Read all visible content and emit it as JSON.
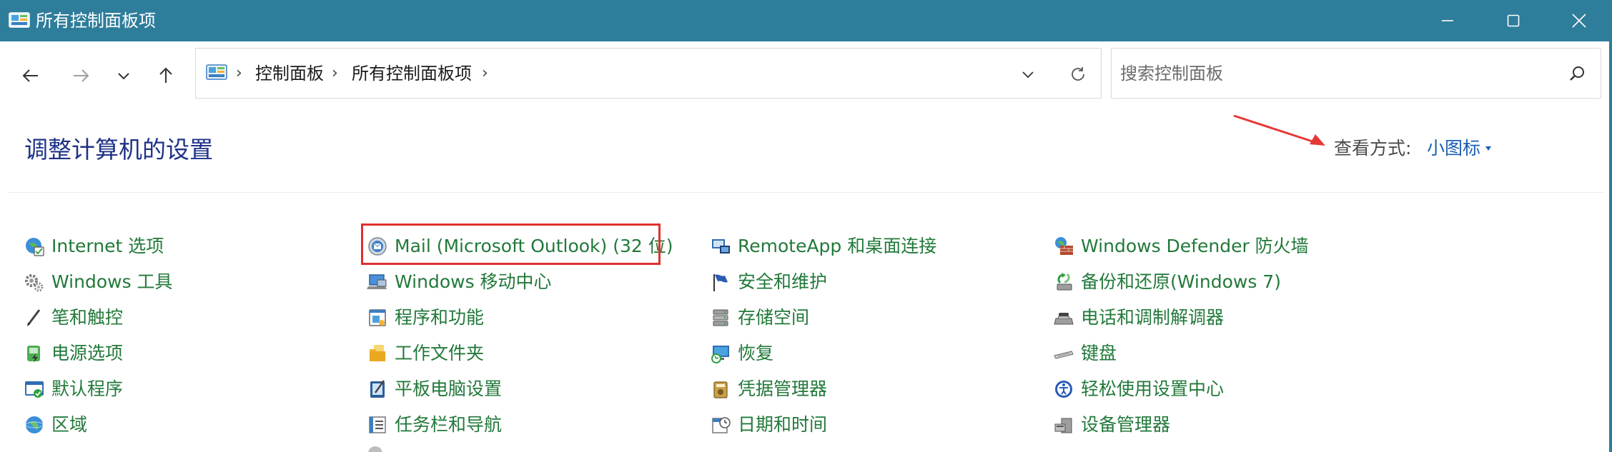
{
  "window": {
    "title": "所有控制面板项",
    "minimize_icon": "minimize-icon",
    "maximize_icon": "maximize-icon",
    "close_icon": "close-icon"
  },
  "navigation": {
    "back_icon": "arrow-left-icon",
    "forward_icon": "arrow-right-icon",
    "recent_icon": "chevron-down-icon",
    "up_icon": "arrow-up-icon",
    "breadcrumbs": [
      "控制面板",
      "所有控制面板项"
    ],
    "refresh_icon": "refresh-icon"
  },
  "search": {
    "placeholder": "搜索控制面板",
    "value": ""
  },
  "header": {
    "title": "调整计算机的设置",
    "view_label": "查看方式:",
    "view_value": "小图标"
  },
  "colors": {
    "titlebar": "#2e7d9b",
    "item_text": "#22793a",
    "title_text": "#1e3287",
    "link_text": "#1a5fb4",
    "highlight": "#e03030"
  },
  "items": {
    "col1": [
      {
        "label": "Internet 选项",
        "icon": "globe-icon"
      },
      {
        "label": "Windows 工具",
        "icon": "gears-icon"
      },
      {
        "label": "笔和触控",
        "icon": "pen-icon"
      },
      {
        "label": "电源选项",
        "icon": "power-icon"
      },
      {
        "label": "默认程序",
        "icon": "default-programs-icon"
      },
      {
        "label": "区域",
        "icon": "region-globe-icon"
      }
    ],
    "col2": [
      {
        "label": "Mail (Microsoft Outlook) (32 位)",
        "icon": "mail-icon"
      },
      {
        "label": "Windows 移动中心",
        "icon": "mobility-center-icon"
      },
      {
        "label": "程序和功能",
        "icon": "programs-icon"
      },
      {
        "label": "工作文件夹",
        "icon": "folder-icon"
      },
      {
        "label": "平板电脑设置",
        "icon": "tablet-icon"
      },
      {
        "label": "任务栏和导航",
        "icon": "taskbar-icon"
      }
    ],
    "col3": [
      {
        "label": "RemoteApp 和桌面连接",
        "icon": "remote-desktop-icon"
      },
      {
        "label": "安全和维护",
        "icon": "flag-icon"
      },
      {
        "label": "存储空间",
        "icon": "storage-icon"
      },
      {
        "label": "恢复",
        "icon": "recovery-icon"
      },
      {
        "label": "凭据管理器",
        "icon": "credential-icon"
      },
      {
        "label": "日期和时间",
        "icon": "clock-icon"
      }
    ],
    "col4": [
      {
        "label": "Windows Defender 防火墙",
        "icon": "firewall-icon"
      },
      {
        "label": "备份和还原(Windows 7)",
        "icon": "backup-icon"
      },
      {
        "label": "电话和调制解调器",
        "icon": "phone-icon"
      },
      {
        "label": "键盘",
        "icon": "keyboard-icon"
      },
      {
        "label": "轻松使用设置中心",
        "icon": "ease-of-access-icon"
      },
      {
        "label": "设备管理器",
        "icon": "device-manager-icon"
      }
    ]
  }
}
